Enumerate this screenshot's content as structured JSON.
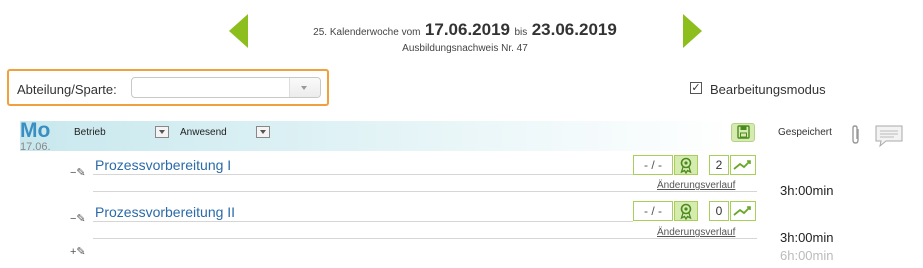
{
  "week": {
    "prefix": "25. Kalenderwoche vom",
    "start_date": "17.06.2019",
    "connector": "bis",
    "end_date": "23.06.2019",
    "report_number": "Ausbildungsnachweis Nr. 47"
  },
  "filter": {
    "label": "Abteilung/Sparte:",
    "value": ""
  },
  "edit_mode": {
    "label": "Bearbeitungsmodus",
    "checked": true,
    "check_glyph": "✓"
  },
  "day": {
    "abbr": "Mo",
    "date": "17.06.",
    "col1_label": "Betrieb",
    "col2_label": "Anwesend",
    "saved_label": "Gespeichert"
  },
  "entries": [
    {
      "toggle": "−✎",
      "title": "Prozessvorbereitung I",
      "status": "- / -",
      "count": "2",
      "history_label": "Änderungsverlauf",
      "time": "3h:00min"
    },
    {
      "toggle": "−✎",
      "title": "Prozessvorbereitung II",
      "status": "- / -",
      "count": "0",
      "history_label": "Änderungsverlauf",
      "time": "3h:00min"
    }
  ],
  "add_entry": {
    "toggle": "+✎"
  },
  "total_time": "6h:00min",
  "colors": {
    "accent_green": "#8cbf1e",
    "highlight_orange": "#f0a03c",
    "day_blue": "#3b8ec2",
    "link_blue": "#2a6aa8"
  },
  "icons": [
    "prev-week-arrow-icon",
    "next-week-arrow-icon",
    "save-disk-icon",
    "paperclip-icon",
    "comment-icon",
    "award-badge-icon",
    "trend-chart-icon",
    "edit-pencil-icon"
  ]
}
